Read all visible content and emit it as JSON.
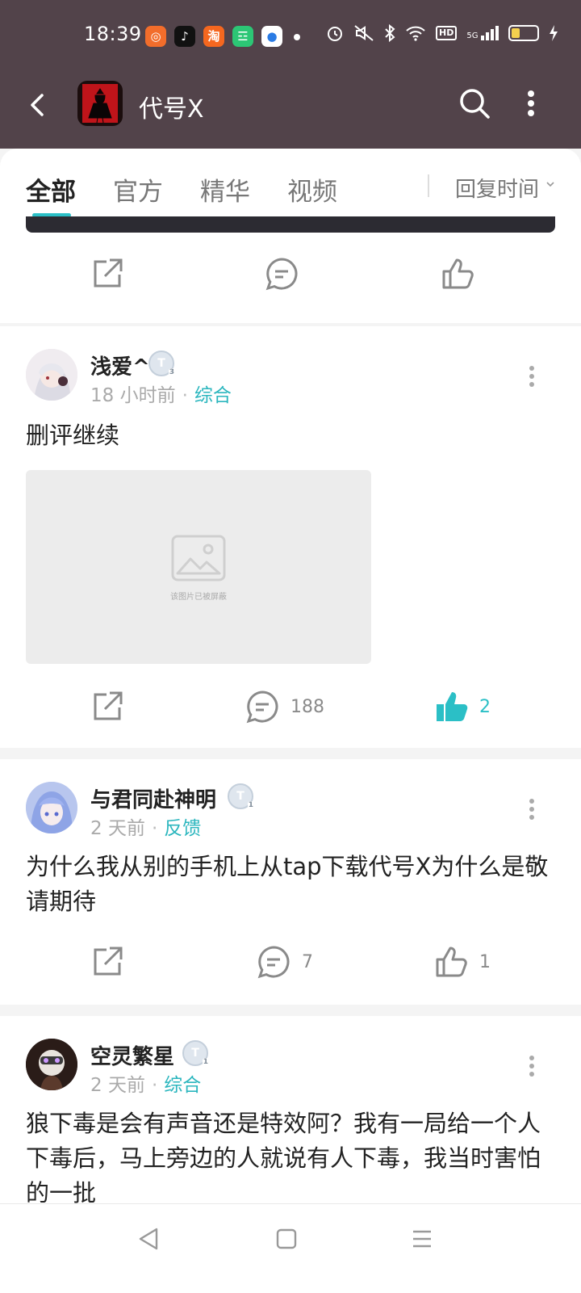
{
  "status_bar": {
    "time": "18:39",
    "apps": [
      {
        "icon": "kuaishou-icon",
        "glyph": "◎",
        "color": "#f26d2b"
      },
      {
        "icon": "douyin-icon",
        "glyph": "♪",
        "color": "#111111"
      },
      {
        "icon": "taobao-icon",
        "glyph": "淘",
        "color": "#f5671f"
      },
      {
        "icon": "shopping-icon",
        "glyph": "☲",
        "color": "#2cc675"
      },
      {
        "icon": "browser-icon",
        "glyph": "●",
        "color": "#ffffff"
      }
    ],
    "hd": "HD",
    "network": "5G"
  },
  "header": {
    "title": "代号X"
  },
  "tabs": {
    "items": [
      {
        "label": "全部",
        "active": true
      },
      {
        "label": "官方",
        "active": false
      },
      {
        "label": "精华",
        "active": false
      },
      {
        "label": "视频",
        "active": false
      }
    ],
    "sort_label": "回复时间"
  },
  "posts": [
    {
      "username": "浅爱^",
      "badge": "T",
      "level": "3",
      "time": "18 小时前",
      "tag": "综合",
      "text": "删评继续",
      "image_placeholder": "该图片已被屏蔽",
      "comments": "188",
      "likes": "2",
      "liked": true
    },
    {
      "username": "与君同赴神明",
      "badge": "T",
      "level": "1",
      "time": "2 天前",
      "tag": "反馈",
      "text": "为什么我从别的手机上从tap下载代号X为什么是敬请期待",
      "comments": "7",
      "likes": "1",
      "liked": false
    },
    {
      "username": "空灵繁星",
      "badge": "T",
      "level": "1",
      "time": "2 天前",
      "tag": "综合",
      "text": "狼下毒是会有声音还是特效阿？我有一局给一个人下毒后，马上旁边的人就说有人下毒，我当时害怕的一批"
    }
  ],
  "colors": {
    "header_bg": "#52434a",
    "accent": "#2bbfc6"
  }
}
